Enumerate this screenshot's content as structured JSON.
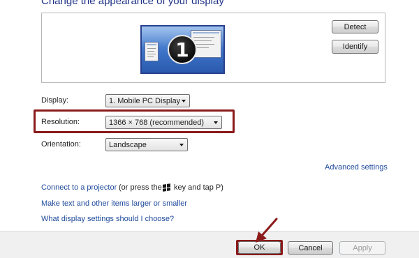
{
  "header": {
    "title": "Change the appearance of your display"
  },
  "preview": {
    "monitor_number": "1",
    "detect_label": "Detect",
    "identify_label": "Identify"
  },
  "settings": {
    "display_label": "Display:",
    "display_value": "1. Mobile PC Display",
    "resolution_label": "Resolution:",
    "resolution_value": "1366 × 768 (recommended)",
    "orientation_label": "Orientation:",
    "orientation_value": "Landscape"
  },
  "links": {
    "advanced_settings": "Advanced settings",
    "connect_projector": "Connect to a projector",
    "projector_hint_prefix": "(or press the",
    "projector_hint_suffix": "key and tap P)",
    "text_size": "Make text and other items larger or smaller",
    "what_settings": "What display settings should I choose?"
  },
  "footer": {
    "ok_label": "OK",
    "cancel_label": "Cancel",
    "apply_label": "Apply"
  },
  "colors": {
    "highlight": "#8b1a1a",
    "link": "#1f4a9c",
    "title": "#1e3287"
  },
  "icons": {
    "windows_key": "windows-logo-icon"
  }
}
